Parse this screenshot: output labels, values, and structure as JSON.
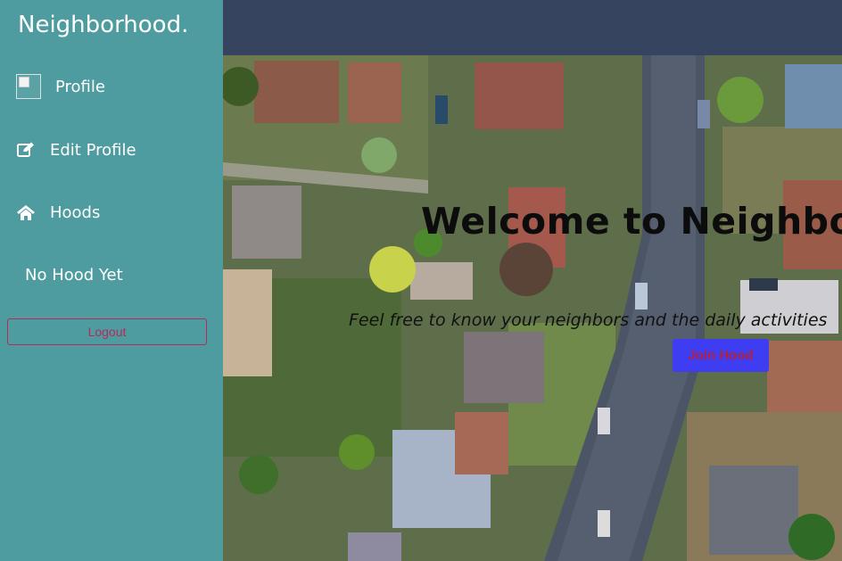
{
  "sidebar": {
    "brand": "Neighborhood.",
    "items": [
      {
        "label": "Profile",
        "icon": "avatar-image"
      },
      {
        "label": "Edit Profile",
        "icon": "edit-icon"
      },
      {
        "label": "Hoods",
        "icon": "home-icon"
      }
    ],
    "no_hood": "No Hood Yet",
    "logout": "Logout"
  },
  "hero": {
    "title": "Welcome to Neighborh",
    "tagline": "Feel free to know your neighbors and the daily activities",
    "join_button": "Join Hood"
  },
  "colors": {
    "sidebar_bg": "#4e9ba0",
    "topbar_bg": "#364460",
    "logout_border": "#b52b5a",
    "join_bg": "#3e3df2",
    "join_text": "#b5203c"
  }
}
